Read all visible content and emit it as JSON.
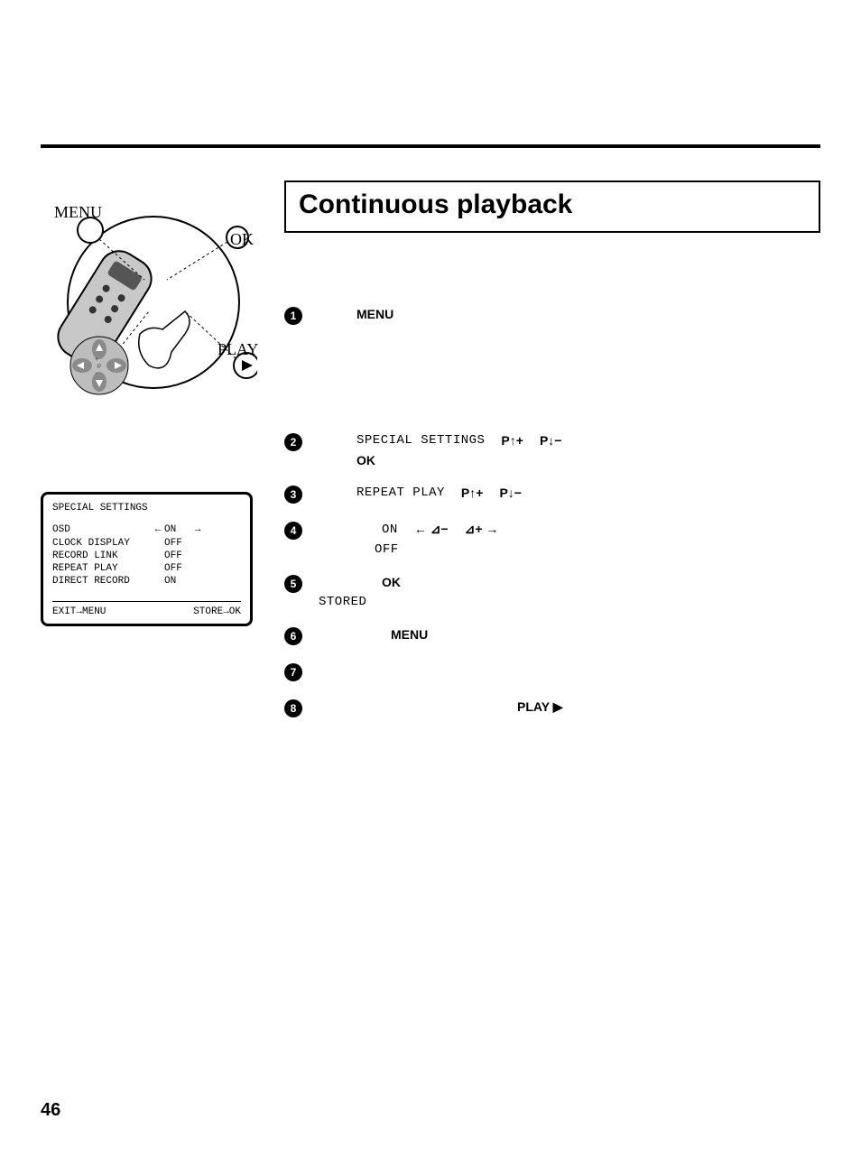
{
  "page_number": "46",
  "title": "Continuous playback",
  "remote": {
    "menu": "MENU",
    "ok": "OK",
    "play": "PLAY"
  },
  "osd": {
    "title": "SPECIAL SETTINGS",
    "rows": [
      {
        "k": "OSD",
        "arr": "←",
        "v": "ON",
        "arr2": "→"
      },
      {
        "k": "CLOCK DISPLAY",
        "arr": "",
        "v": "OFF",
        "arr2": ""
      },
      {
        "k": "RECORD LINK",
        "arr": "",
        "v": "OFF",
        "arr2": ""
      },
      {
        "k": "REPEAT PLAY",
        "arr": "",
        "v": "OFF",
        "arr2": ""
      },
      {
        "k": "DIRECT RECORD",
        "arr": "",
        "v": "ON",
        "arr2": ""
      }
    ],
    "exit": "EXIT→MENU",
    "store": "STORE→OK"
  },
  "steps": {
    "s1": {
      "n": "1",
      "a": "MENU"
    },
    "s2": {
      "n": "2",
      "a": "SPECIAL SETTINGS",
      "b": "P↑+",
      "c": "P↓−",
      "d": "OK"
    },
    "s3": {
      "n": "3",
      "a": "REPEAT PLAY",
      "b": "P↑+",
      "c": "P↓−"
    },
    "s4": {
      "n": "4",
      "a": "ON",
      "b": "← ⊿−",
      "c": "⊿+ →",
      "d": "OFF"
    },
    "s5": {
      "n": "5",
      "a": "OK",
      "b": "STORED"
    },
    "s6": {
      "n": "6",
      "a": "MENU"
    },
    "s7": {
      "n": "7"
    },
    "s8": {
      "n": "8",
      "a": "PLAY ▶"
    }
  }
}
